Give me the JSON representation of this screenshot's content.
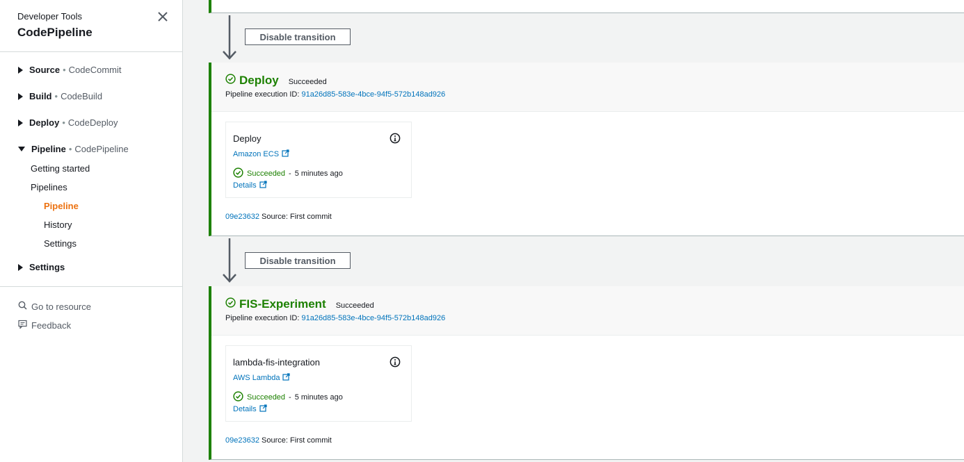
{
  "sidebar": {
    "subtitle": "Developer Tools",
    "title": "CodePipeline",
    "groups": [
      {
        "label": "Source",
        "service": "CodeCommit"
      },
      {
        "label": "Build",
        "service": "CodeBuild"
      },
      {
        "label": "Deploy",
        "service": "CodeDeploy"
      },
      {
        "label": "Pipeline",
        "service": "CodePipeline"
      }
    ],
    "dot": "•",
    "links": {
      "getting_started": "Getting started",
      "pipelines": "Pipelines",
      "pipeline": "Pipeline",
      "history": "History",
      "settings_sub": "Settings"
    },
    "settings_group": "Settings",
    "go_to_resource": "Go to resource",
    "feedback": "Feedback"
  },
  "transition": {
    "button_label": "Disable transition"
  },
  "stages": [
    {
      "name": "Deploy",
      "status": "Succeeded",
      "execution_label": "Pipeline execution ID:",
      "execution_id": "91a26d85-583e-4bce-94f5-572b148ad926",
      "action": {
        "name": "Deploy",
        "provider": "Amazon ECS",
        "status": "Succeeded",
        "separator": "-",
        "time": "5 minutes ago",
        "details": "Details"
      },
      "commit_id": "09e23632",
      "commit_message": "Source: First commit"
    },
    {
      "name": "FIS-Experiment",
      "status": "Succeeded",
      "execution_label": "Pipeline execution ID:",
      "execution_id": "91a26d85-583e-4bce-94f5-572b148ad926",
      "action": {
        "name": "lambda-fis-integration",
        "provider": "AWS Lambda",
        "status": "Succeeded",
        "separator": "-",
        "time": "5 minutes ago",
        "details": "Details"
      },
      "commit_id": "09e23632",
      "commit_message": "Source: First commit"
    }
  ],
  "colors": {
    "success": "#1d8102",
    "link": "#0073bb",
    "active_nav": "#ec7211"
  },
  "icons": {
    "close": "close-icon",
    "caret_right": "caret-right-icon",
    "caret_down": "caret-down-icon",
    "search": "search-icon",
    "feedback": "feedback-icon",
    "success": "check-circle-icon",
    "info": "info-icon",
    "external": "external-link-icon",
    "arrow": "arrow-down-icon"
  }
}
